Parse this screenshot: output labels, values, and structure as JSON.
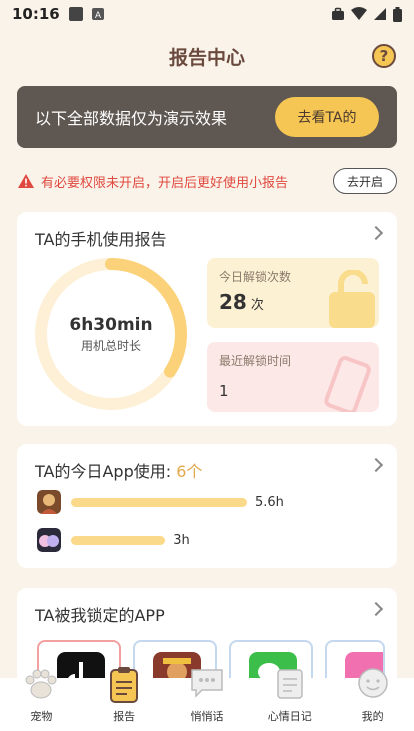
{
  "status_bar": {
    "time": "10:16"
  },
  "header": {
    "title": "报告中心",
    "help_icon": "question-icon"
  },
  "demo_banner": {
    "text": "以下全部数据仅为演示效果",
    "button": "去看TA的"
  },
  "permission": {
    "text": "有必要权限未开启，开启后更好使用小报告",
    "button": "去开启"
  },
  "phone_report": {
    "title": "TA的手机使用报告",
    "total_time": "6h30min",
    "total_label": "用机总时长",
    "ring_progress": 0.34,
    "unlock_label": "今日解锁次数",
    "unlock_value": "28",
    "unlock_unit": "次",
    "last_unlock_label": "最近解锁时间",
    "last_unlock_value": "1"
  },
  "app_usage": {
    "title_prefix": "TA的今日App使用:",
    "count": "6个",
    "apps": [
      {
        "icon": "game-avatar-icon",
        "duration": "5.6h",
        "hours": 5.6
      },
      {
        "icon": "cute-app-icon",
        "duration": "3h",
        "hours": 3
      }
    ]
  },
  "locked_apps": {
    "title": "TA被我锁定的APP",
    "apps": [
      "tiktok-icon",
      "game-icon",
      "wechat-icon",
      "pink-app-icon"
    ]
  },
  "tabbar": [
    {
      "label": "宠物",
      "icon": "paw-icon"
    },
    {
      "label": "报告",
      "icon": "report-icon",
      "active": true
    },
    {
      "label": "悄悄话",
      "icon": "chat-icon"
    },
    {
      "label": "心情日记",
      "icon": "diary-icon"
    },
    {
      "label": "我的",
      "icon": "profile-icon"
    }
  ],
  "colors": {
    "accent": "#f6c654",
    "banner": "#5f5752",
    "warning": "#e0493f",
    "background": "#faf3ea"
  }
}
